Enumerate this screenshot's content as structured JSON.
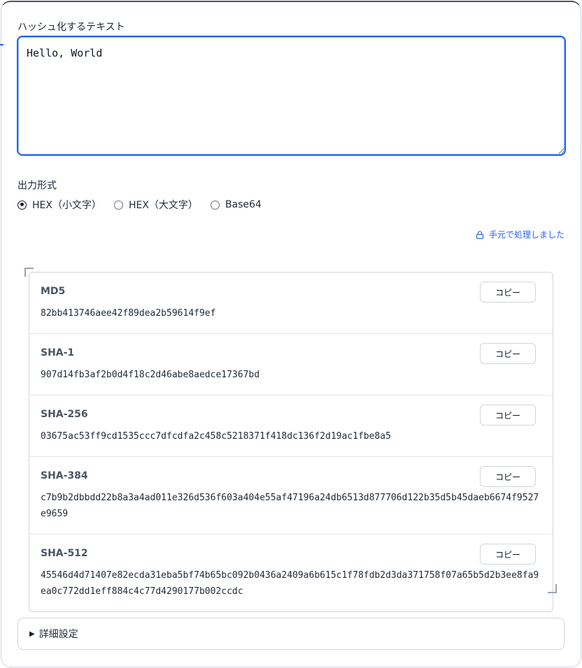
{
  "input": {
    "label": "ハッシュ化するテキスト",
    "value": "Hello, World"
  },
  "format": {
    "label": "出力形式",
    "options": [
      {
        "label": "HEX（小文字）",
        "selected": true
      },
      {
        "label": "HEX（大文字）",
        "selected": false
      },
      {
        "label": "Base64",
        "selected": false
      }
    ]
  },
  "local_note": "手元で処理しました",
  "results": [
    {
      "algo": "MD5",
      "hash": "82bb413746aee42f89dea2b59614f9ef",
      "copy_label": "コピー"
    },
    {
      "algo": "SHA-1",
      "hash": "907d14fb3af2b0d4f18c2d46abe8aedce17367bd",
      "copy_label": "コピー"
    },
    {
      "algo": "SHA-256",
      "hash": "03675ac53ff9cd1535ccc7dfcdfa2c458c5218371f418dc136f2d19ac1fbe8a5",
      "copy_label": "コピー"
    },
    {
      "algo": "SHA-384",
      "hash": "c7b9b2dbbdd22b8a3a4ad011e326d536f603a404e55af47196a24db6513d877706d122b35d5b45daeb6674f9527e9659",
      "copy_label": "コピー"
    },
    {
      "algo": "SHA-512",
      "hash": "45546d4d71407e82ecda31eba5bf74b65bc092b0436a2409a6b615c1f78fdb2d3da371758f07a65b5d2b3ee8fa9ea0c772dd1eff884c4c77d4290177b002ccdc",
      "copy_label": "コピー"
    }
  ],
  "advanced": {
    "label": "詳細設定"
  }
}
